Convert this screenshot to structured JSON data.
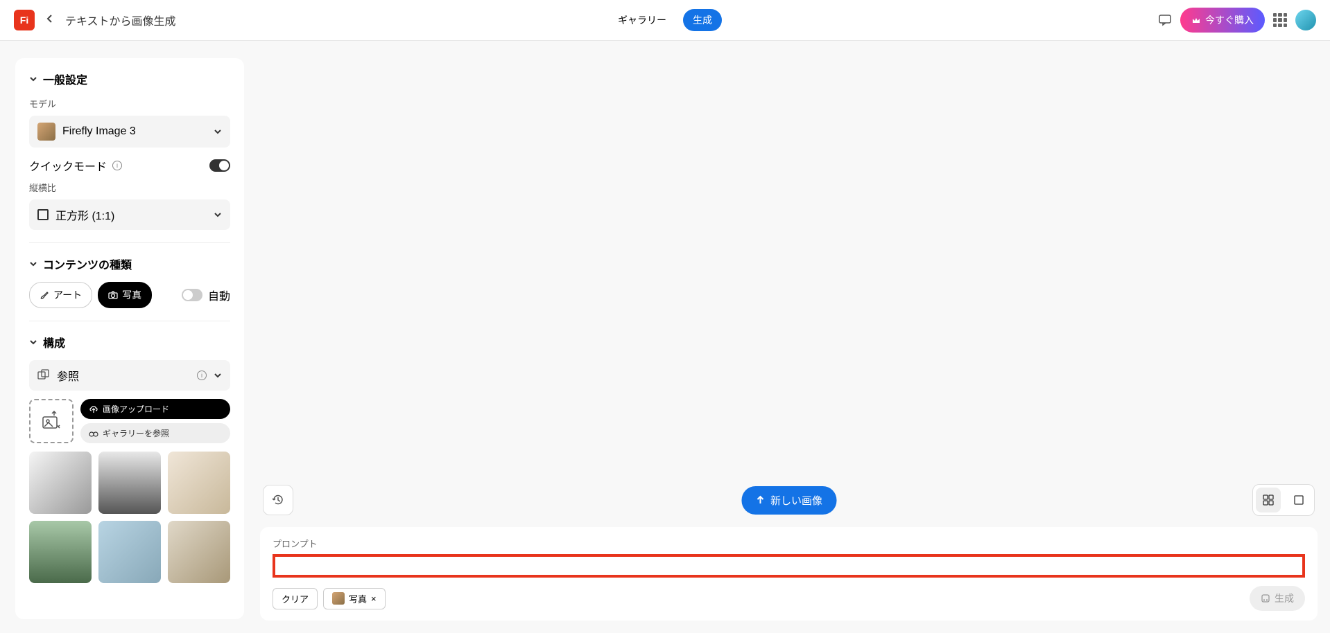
{
  "header": {
    "logo_text": "Fi",
    "page_title": "テキストから画像生成",
    "tabs": {
      "gallery": "ギャラリー",
      "generate": "生成"
    },
    "buy_now": "今すぐ購入"
  },
  "sidebar": {
    "general": {
      "title": "一般設定",
      "model_label": "モデル",
      "model_value": "Firefly Image 3",
      "quick_mode": "クイックモード",
      "aspect_label": "縦横比",
      "aspect_value": "正方形 (1:1)"
    },
    "content_type": {
      "title": "コンテンツの種類",
      "art": "アート",
      "photo": "写真",
      "auto": "自動"
    },
    "composition": {
      "title": "構成",
      "reference": "参照",
      "upload": "画像アップロード",
      "browse_gallery": "ギャラリーを参照"
    }
  },
  "bottom": {
    "new_image": "新しい画像",
    "prompt_label": "プロンプト",
    "clear": "クリア",
    "photo_chip": "写真",
    "generate": "生成"
  }
}
